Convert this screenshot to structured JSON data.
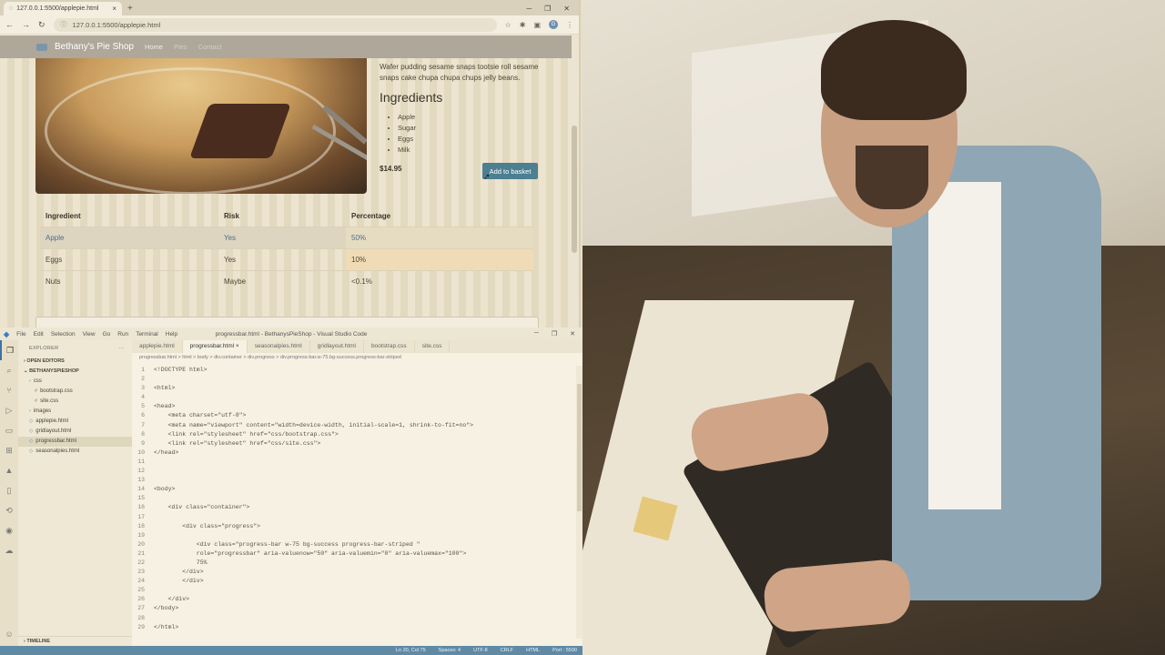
{
  "browser": {
    "tab_title": "127.0.0.1:5500/applepie.html",
    "url": "127.0.0.1:5500/applepie.html",
    "avatar_letter": "G",
    "nav": {
      "brand": "Bethany's Pie Shop",
      "links": [
        "Home",
        "Pies",
        "Contact"
      ]
    },
    "product": {
      "description": "Wafer pudding sesame snaps tootsie roll sesame snaps cake chupa chupa chups jelly beans.",
      "ingredients_title": "Ingredients",
      "ingredients": [
        "Apple",
        "Sugar",
        "Eggs",
        "Milk"
      ],
      "price": "$14.95",
      "basket_button": "Add to basket"
    },
    "table": {
      "headers": [
        "Ingredient",
        "Risk",
        "Percentage"
      ],
      "rows": [
        [
          "Apple",
          "Yes",
          "50%"
        ],
        [
          "Eggs",
          "Yes",
          "10%"
        ],
        [
          "Nuts",
          "Maybe",
          "<0.1%"
        ]
      ]
    }
  },
  "vscode": {
    "menu": [
      "File",
      "Edit",
      "Selection",
      "View",
      "Go",
      "Run",
      "Terminal",
      "Help"
    ],
    "window_title": "progressbar.html - BethanysPieShop - Visual Studio Code",
    "explorer": {
      "title": "EXPLORER",
      "open_editors": "OPEN EDITORS",
      "project": "BETHANYSPIESHOP",
      "tree": [
        {
          "label": "css",
          "depth": 1,
          "kind": "folder"
        },
        {
          "label": "bootstrap.css",
          "depth": 2,
          "kind": "css"
        },
        {
          "label": "site.css",
          "depth": 2,
          "kind": "css"
        },
        {
          "label": "images",
          "depth": 1,
          "kind": "folder"
        },
        {
          "label": "applepie.html",
          "depth": 1,
          "kind": "html"
        },
        {
          "label": "gridlayout.html",
          "depth": 1,
          "kind": "html"
        },
        {
          "label": "progressbar.html",
          "depth": 1,
          "kind": "html",
          "selected": true
        },
        {
          "label": "seasonalpies.html",
          "depth": 1,
          "kind": "html"
        }
      ],
      "timeline": "TIMELINE"
    },
    "tabs": [
      "applepie.html",
      "progressbar.html",
      "seasonalpies.html",
      "gridlayout.html",
      "bootstrap.css",
      "site.css"
    ],
    "active_tab": 1,
    "breadcrumb": "progressbar.html > html > body > div.container > div.progress > div.progress-bar.w-75.bg-success.progress-bar-striped",
    "code_lines": [
      {
        "n": "1",
        "t": "<!DOCTYPE html>"
      },
      {
        "n": "2",
        "t": ""
      },
      {
        "n": "3",
        "t": "<html>"
      },
      {
        "n": "4",
        "t": ""
      },
      {
        "n": "5",
        "t": "<head>"
      },
      {
        "n": "6",
        "t": "    <meta charset=\"utf-8\">"
      },
      {
        "n": "7",
        "t": "    <meta name=\"viewport\" content=\"width=device-width, initial-scale=1, shrink-to-fit=no\">"
      },
      {
        "n": "8",
        "t": "    <link rel=\"stylesheet\" href=\"css/bootstrap.css\">"
      },
      {
        "n": "9",
        "t": "    <link rel=\"stylesheet\" href=\"css/site.css\">"
      },
      {
        "n": "10",
        "t": "</head>"
      },
      {
        "n": "11",
        "t": ""
      },
      {
        "n": "12",
        "t": ""
      },
      {
        "n": "13",
        "t": ""
      },
      {
        "n": "14",
        "t": "<body>"
      },
      {
        "n": "15",
        "t": ""
      },
      {
        "n": "16",
        "t": "    <div class=\"container\">"
      },
      {
        "n": "17",
        "t": ""
      },
      {
        "n": "18",
        "t": "        <div class=\"progress\">"
      },
      {
        "n": "19",
        "t": ""
      },
      {
        "n": "20",
        "t": "            <div class=\"progress-bar w-75 bg-success progress-bar-striped \""
      },
      {
        "n": "21",
        "t": "            role=\"progressbar\" aria-valuenow=\"50\" aria-valuemin=\"0\" aria-valuemax=\"100\">"
      },
      {
        "n": "22",
        "t": "            75%"
      },
      {
        "n": "23",
        "t": "        </div>"
      },
      {
        "n": "24",
        "t": "        </div>"
      },
      {
        "n": "25",
        "t": ""
      },
      {
        "n": "26",
        "t": "    </div>"
      },
      {
        "n": "27",
        "t": "</body>"
      },
      {
        "n": "28",
        "t": ""
      },
      {
        "n": "29",
        "t": "</html>"
      }
    ],
    "status": [
      "Ln 20, Col 75",
      "Spaces: 4",
      "UTF-8",
      "CRLF",
      "HTML",
      "Port : 5500"
    ]
  },
  "colors": {
    "navbar": "#aea79a",
    "button": "#4c7f91",
    "statusbar": "#5e8aa6",
    "accent_link": "#4b6f8f"
  }
}
